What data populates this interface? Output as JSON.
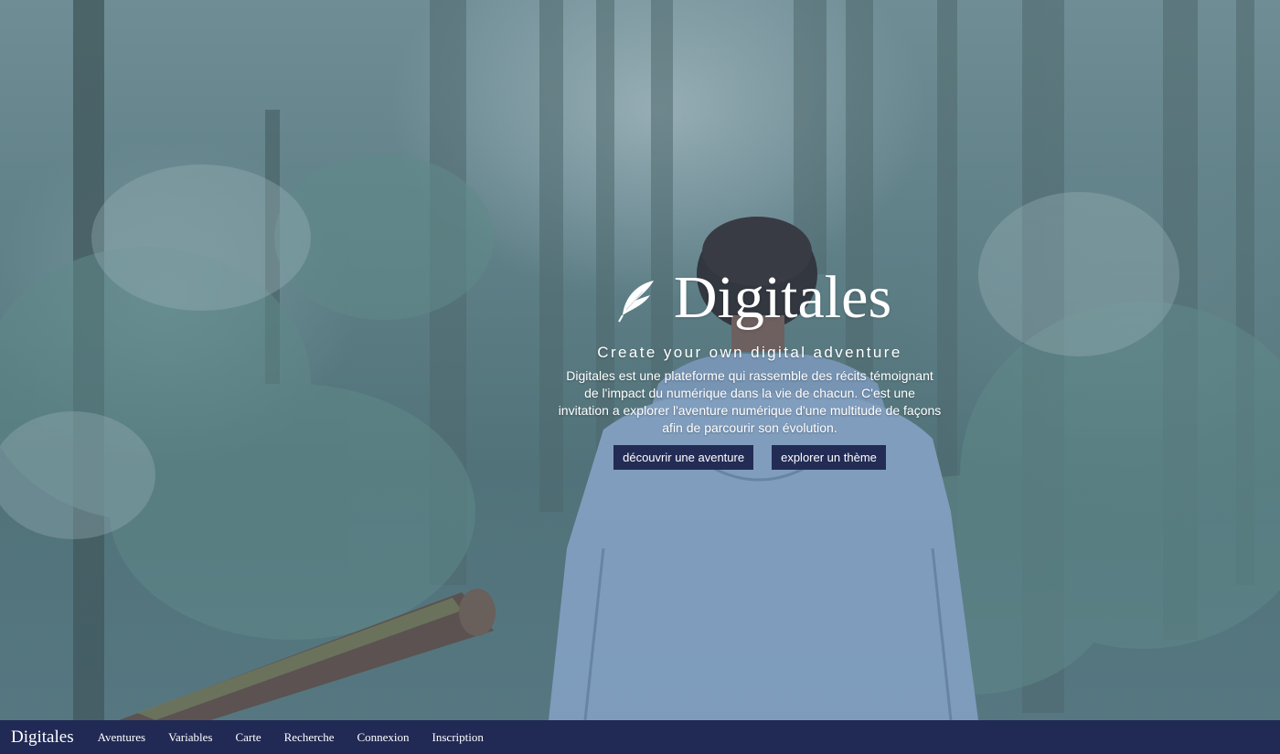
{
  "hero": {
    "logo_icon": "feather-icon",
    "title": "Digitales",
    "subtitle": "Create your own digital adventure",
    "description": "Digitales est une plateforme qui rassemble des récits témoignant de l'impact du numérique dans la vie de chacun. C'est une invitation a explorer l'aventure numérique d'une multitude de façons afin de parcourir son évolution.",
    "buttons": [
      {
        "label": "découvrir une aventure"
      },
      {
        "label": "explorer un thème"
      }
    ]
  },
  "navbar": {
    "brand": "Digitales",
    "links": [
      {
        "label": "Aventures"
      },
      {
        "label": "Variables"
      },
      {
        "label": "Carte"
      },
      {
        "label": "Recherche"
      },
      {
        "label": "Connexion"
      },
      {
        "label": "Inscription"
      }
    ]
  },
  "colors": {
    "navbar_bg": "#212a55",
    "button_bg": "#232c55",
    "text": "#ffffff"
  }
}
